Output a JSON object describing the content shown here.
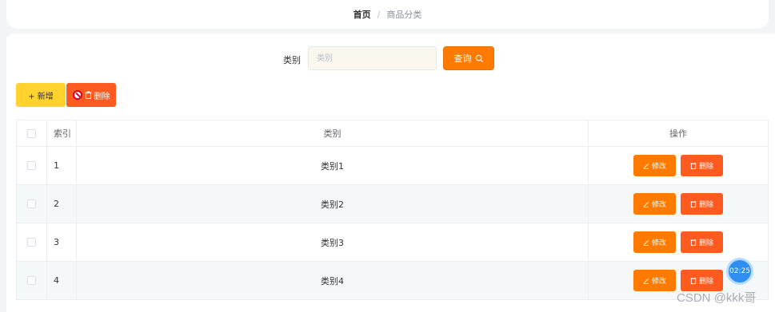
{
  "breadcrumb": {
    "home": "首页",
    "separator": "/",
    "current": "商品分类"
  },
  "search": {
    "label": "类别",
    "placeholder": "类别",
    "query_label": "查询"
  },
  "toolbar": {
    "add_label": "+ 新增",
    "delete_label": "删除"
  },
  "table": {
    "headers": {
      "index": "索引",
      "category": "类别",
      "operation": "操作"
    },
    "rows": [
      {
        "index": "1",
        "category": "类别1"
      },
      {
        "index": "2",
        "category": "类别2"
      },
      {
        "index": "3",
        "category": "类别3"
      },
      {
        "index": "4",
        "category": "类别4"
      }
    ],
    "edit_label": "修改",
    "delete_label": "删除"
  },
  "timer": "02:25",
  "watermark": "CSDN @kkk哥",
  "colors": {
    "primary": "#ff7a00",
    "danger": "#ff5a1f",
    "warning": "#ffd22e"
  }
}
